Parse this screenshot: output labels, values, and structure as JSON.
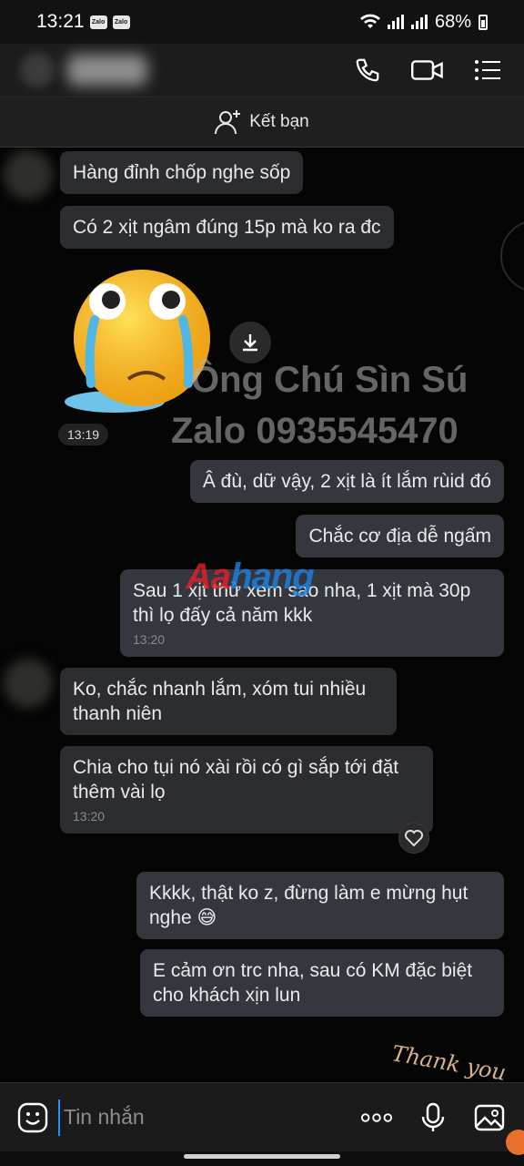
{
  "status_bar": {
    "time": "13:21",
    "app_badges": [
      "Zalo",
      "Zalo"
    ],
    "battery": "68%"
  },
  "header": {
    "actions": [
      "phone-icon",
      "video-camera-icon",
      "menu-icon"
    ]
  },
  "add_friend": {
    "label": "Kết bạn"
  },
  "messages": [
    {
      "text": "Hàng đỉnh chốp nghe sốp"
    },
    {
      "text": "Có 2 xịt ngâm đúng 15p mà ko ra đc"
    },
    {
      "text": "Â đù, dữ vậy, 2 xịt là ít lắm rùid đó"
    },
    {
      "text": "Chắc cơ địa dễ ngấm"
    },
    {
      "text_line1": "Sau 1 xịt thử xem sao nha, 1 xịt mà 30p",
      "text_line2": "thì lọ đấy cả năm kkk",
      "time": "13:20"
    },
    {
      "text_line1": "Ko, chắc nhanh lắm, xóm tui nhiều",
      "text_line2": "thanh niên"
    },
    {
      "text_line1": "Chia cho tụi nó xài rồi có gì sắp tới đặt",
      "text_line2": "thêm vài lọ",
      "time": "13:20"
    },
    {
      "text_line1": "Kkkk, thật ko z, đừng làm e mừng hụt",
      "text_line2": "nghe 😅"
    },
    {
      "text_line1": "E cảm ơn trc nha, sau có KM đặc biệt",
      "text_line2": "cho khách xịn lun"
    }
  ],
  "sticker": {
    "time": "13:19"
  },
  "watermark": {
    "line1": "Ông Chú Sìn Sú",
    "line2": "Zalo 0935545470"
  },
  "brand_mark": {
    "part1": "Aa",
    "part2": "hang"
  },
  "thank_sticker": "Thank you",
  "input": {
    "placeholder": "Tin nhắn"
  },
  "colors": {
    "bubble_in": "#2c2d31",
    "bubble_out": "#34383e",
    "background": "#050505",
    "cursor": "#1e90ff"
  }
}
